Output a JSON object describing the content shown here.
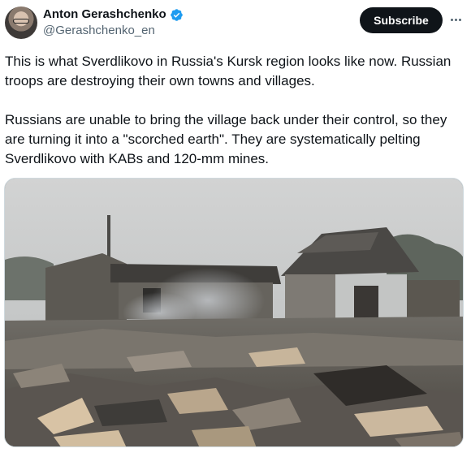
{
  "author": {
    "display_name": "Anton Gerashchenko",
    "handle": "@Gerashchenko_en",
    "verified": true,
    "verified_color": "#1d9bf0"
  },
  "actions": {
    "subscribe_label": "Subscribe",
    "more_icon": "more-horizontal-icon"
  },
  "tweet": {
    "paragraph_1": "This is what Sverdlikovo in Russia's Kursk region looks like now. Russian troops are destroying their own towns and villages.",
    "paragraph_2": "Russians are unable to bring the village back under their control, so they are turning it into a \"scorched earth\".  They are systematically pelting Sverdlikovo with KABs and 120-mm mines."
  },
  "colors": {
    "text": "#0f1419",
    "secondary_text": "#536471",
    "button_bg": "#0f1419",
    "button_text": "#ffffff"
  }
}
